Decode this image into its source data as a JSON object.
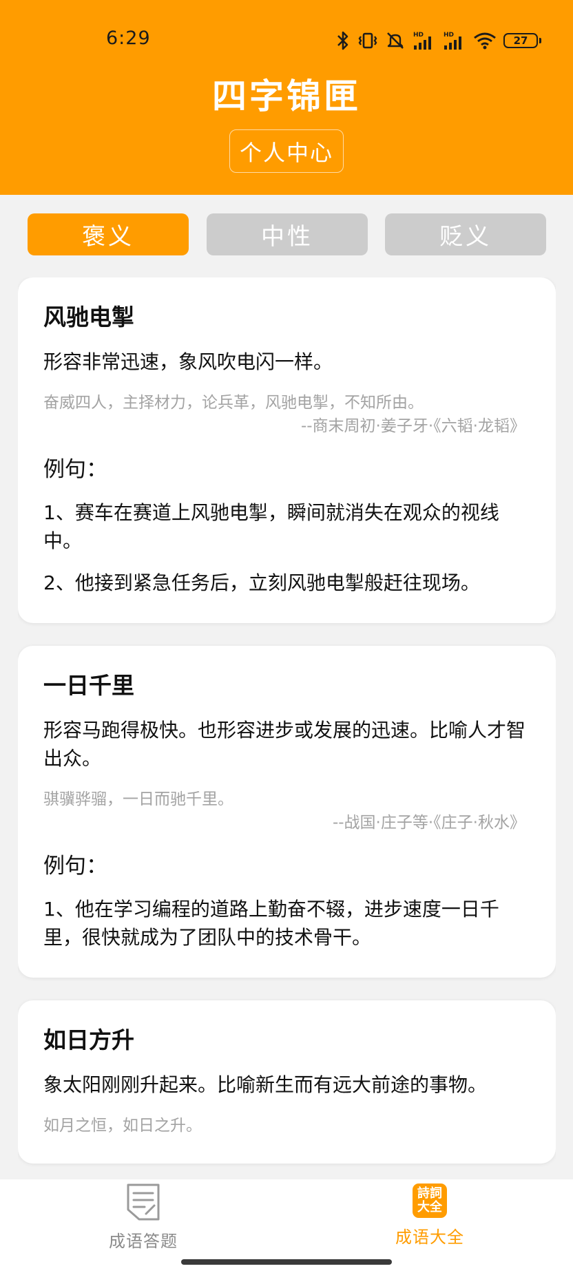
{
  "status_bar": {
    "time": "6:29",
    "battery": "27",
    "icons": [
      "bluetooth-icon",
      "vibrate-icon",
      "mute-icon",
      "hd-signal-icon",
      "hd-signal-icon",
      "wifi-icon",
      "battery-icon"
    ]
  },
  "header": {
    "title": "四字锦匣",
    "personal_center": "个人中心",
    "color": "#ff9c00"
  },
  "tabs": [
    {
      "label": "褒义",
      "active": true
    },
    {
      "label": "中性",
      "active": false
    },
    {
      "label": "贬义",
      "active": false
    }
  ],
  "idioms": [
    {
      "name": "风驰电掣",
      "meaning": "形容非常迅速，象风吹电闪一样。",
      "source": "奋威四人，主择材力，论兵革，风驰电掣，不知所由。",
      "origin": "--商末周初·姜子牙·《六韬·龙韬》",
      "example_heading": "例句：",
      "examples": [
        "1、赛车在赛道上风驰电掣，瞬间就消失在观众的视线中。",
        "2、他接到紧急任务后，立刻风驰电掣般赶往现场。"
      ]
    },
    {
      "name": "一日千里",
      "meaning": "形容马跑得极快。也形容进步或发展的迅速。比喻人才智出众。",
      "source": "骐骥骅骝，一日而驰千里。",
      "origin": "--战国·庄子等·《庄子·秋水》",
      "example_heading": "例句：",
      "examples": [
        "1、他在学习编程的道路上勤奋不辍，进步速度一日千里，很快就成为了团队中的技术骨干。"
      ]
    },
    {
      "name": "如日方升",
      "meaning": "象太阳刚刚升起来。比喻新生而有远大前途的事物。",
      "source": "如月之恒，如日之升。"
    }
  ],
  "bottom_nav": [
    {
      "label": "成语答题",
      "icon": "quiz-document-icon",
      "active": false
    },
    {
      "label": "成语大全",
      "icon": "poem-collection-icon",
      "icon_text": [
        "詩詞",
        "大全"
      ],
      "active": true
    }
  ]
}
